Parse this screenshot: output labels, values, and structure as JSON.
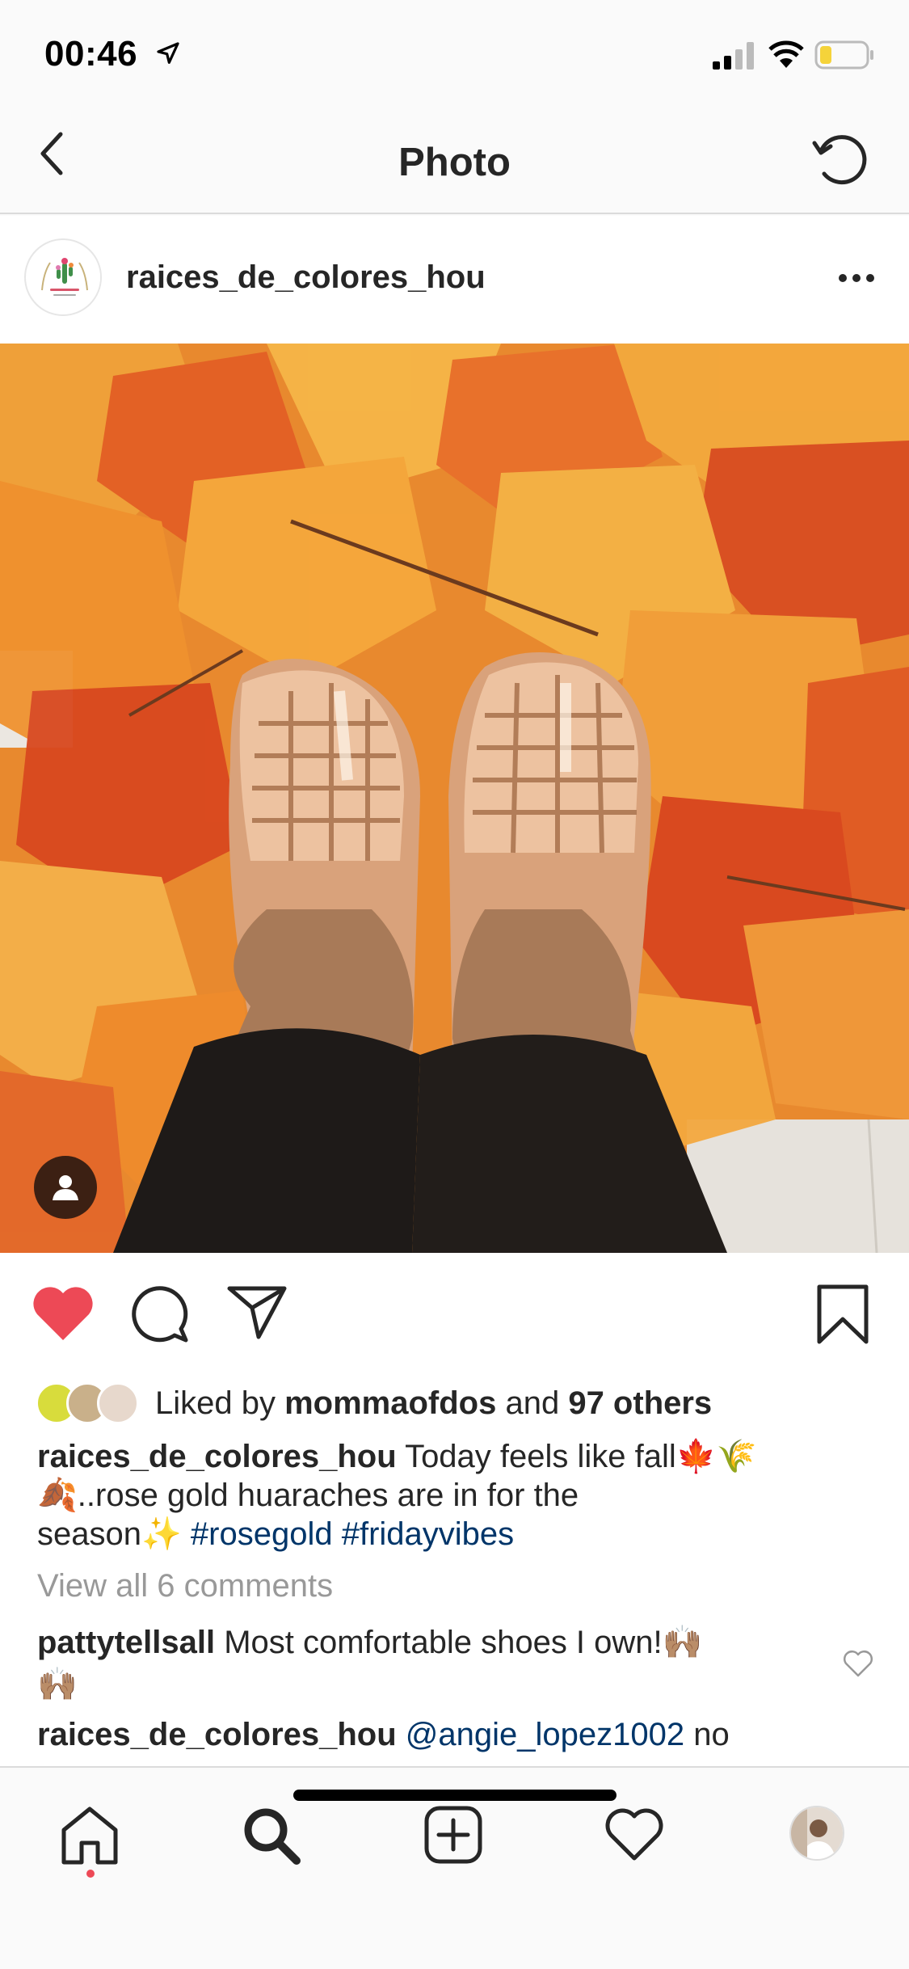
{
  "status_bar": {
    "time": "00:46"
  },
  "nav": {
    "title": "Photo"
  },
  "post": {
    "username": "raices_de_colores_hou",
    "photo_alt": "Rose gold huaraches on autumn leaves"
  },
  "likes": {
    "prefix": "Liked by ",
    "user": "mommaofdos",
    "middle": " and ",
    "others": "97 others"
  },
  "caption": {
    "username": "raices_de_colores_hou",
    "text1": " Today feels like fall🍁🌾",
    "text2": "🍂..rose gold huaraches are in for the",
    "text3": "season✨ ",
    "hashtag1": "#rosegold",
    "hashtag2": "#fridayvibes"
  },
  "view_comments": "View all 6 comments",
  "comments": [
    {
      "username": "pattytellsall",
      "text": " Most comfortable shoes I own!🙌🏽",
      "text2": "🙌🏽"
    },
    {
      "username": "raices_de_colores_hou",
      "mention": "@angie_lopez1002",
      "text": " no"
    }
  ],
  "colors": {
    "like": "#ed4956",
    "link": "#003569",
    "muted": "#999999"
  }
}
